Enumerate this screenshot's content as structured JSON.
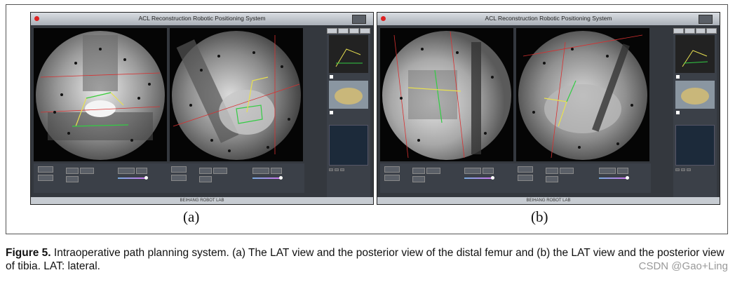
{
  "figure": {
    "app_title": "ACL Reconstruction Robotic Positioning System",
    "lab_name": "BEIHANG ROBOT LAB",
    "label_a": "(a)",
    "label_b": "(b)"
  },
  "caption": {
    "label": "Figure 5.",
    "text": " Intraoperative path planning system. (a) The LAT view and the posterior view of the distal femur and (b) the LAT view and the posterior view of tibia. LAT: lateral."
  },
  "watermark": "CSDN @Gao+Ling",
  "colors": {
    "panel_bg": "#34383e",
    "planning_green": "#33cc44",
    "planning_yellow": "#e8e050",
    "guide_red": "#d83030"
  }
}
